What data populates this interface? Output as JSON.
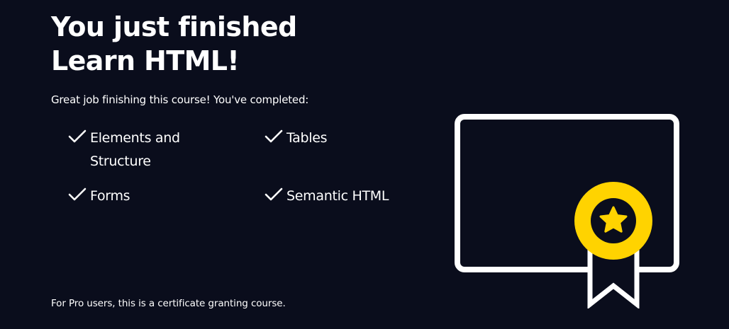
{
  "heading": {
    "line1": "You just finished",
    "line2": "Learn HTML!"
  },
  "intro": "Great job finishing this course! You've completed:",
  "topics": [
    {
      "label_line1": "Elements and",
      "label_line2": "Structure",
      "icon": "checkmark-icon"
    },
    {
      "label_line1": "Tables",
      "label_line2": "",
      "icon": "checkmark-icon"
    },
    {
      "label_line1": "Forms",
      "label_line2": "",
      "icon": "checkmark-icon"
    },
    {
      "label_line1": "Semantic HTML",
      "label_line2": "",
      "icon": "checkmark-icon"
    }
  ],
  "footer_note": "For Pro users, this is a certificate granting course.",
  "illustration": {
    "icon": "certificate-icon",
    "badge_icon": "star-icon"
  },
  "colors": {
    "background": "#0a0d1c",
    "text": "#ffffff",
    "accent": "#ffd300",
    "certificate_outline": "#ffffff"
  }
}
